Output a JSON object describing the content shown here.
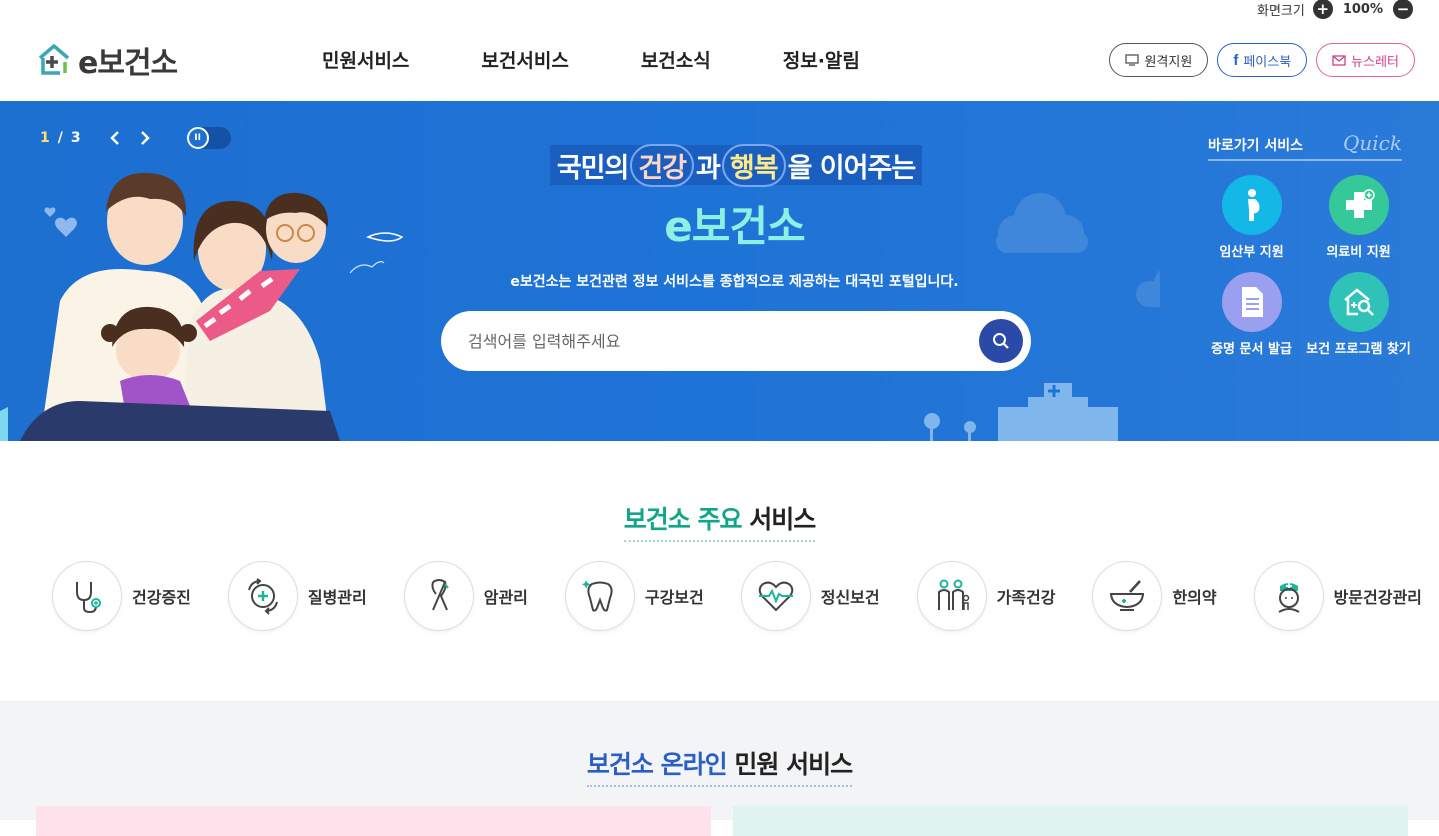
{
  "util": {
    "zoom_label": "화면크기",
    "zoom_in": "+",
    "zoom_value": "100%",
    "zoom_out": "−"
  },
  "header": {
    "logo": "e보건소",
    "nav": [
      "민원서비스",
      "보건서비스",
      "보건소식",
      "정보·알림"
    ],
    "buttons": {
      "remote": "원격지원",
      "facebook": "페이스북",
      "newsletter": "뉴스레터"
    }
  },
  "hero": {
    "slide_current": "1",
    "slide_sep": "/",
    "slide_total": "3",
    "tag_pre": "국민의",
    "tag_h1": "건강",
    "tag_mid": "과",
    "tag_h2": "행복",
    "tag_post": "을 이어주는",
    "brand": "e보건소",
    "desc": "e보건소는 보건관련 정보 서비스를 종합적으로 제공하는 대국민 포털입니다.",
    "search_placeholder": "검색어를 입력해주세요"
  },
  "quick": {
    "title": "바로가기 서비스",
    "title_en": "Quick",
    "items": [
      {
        "label": "임산부 지원",
        "color": "#14b8e6",
        "icon": "pregnant-icon"
      },
      {
        "label": "의료비 지원",
        "color": "#35c99a",
        "icon": "medical-cross-icon"
      },
      {
        "label": "증명 문서 발급",
        "color": "#9b9ff0",
        "icon": "document-icon"
      },
      {
        "label": "보건 프로그램 찾기",
        "color": "#2fc2b8",
        "icon": "house-search-icon"
      }
    ]
  },
  "main_services": {
    "title_green": "보건소 주요",
    "title_rest": "서비스",
    "items": [
      {
        "label": "건강증진",
        "icon": "stethoscope-icon"
      },
      {
        "label": "질병관리",
        "icon": "disease-icon"
      },
      {
        "label": "암관리",
        "icon": "ribbon-icon"
      },
      {
        "label": "구강보건",
        "icon": "tooth-icon"
      },
      {
        "label": "정신보건",
        "icon": "heart-pulse-icon"
      },
      {
        "label": "가족건강",
        "icon": "family-icon"
      },
      {
        "label": "한의약",
        "icon": "mortar-icon"
      },
      {
        "label": "방문건강관리",
        "icon": "nurse-icon"
      }
    ]
  },
  "online": {
    "title_blue": "보건소 온라인",
    "title_rest": "민원 서비스"
  }
}
